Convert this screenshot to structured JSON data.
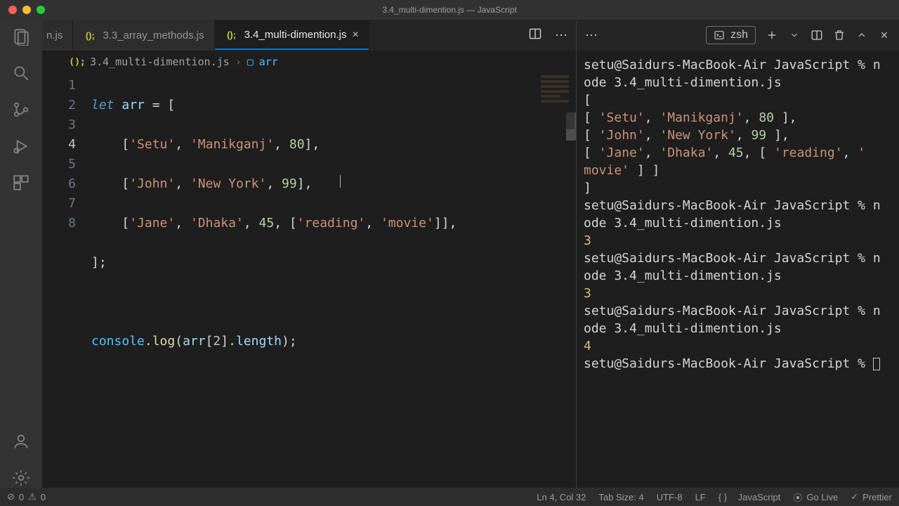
{
  "window": {
    "title": "3.4_multi-dimention.js — JavaScript"
  },
  "tabs": {
    "partial": "n.js",
    "t1": "3.3_array_methods.js",
    "t2": "3.4_multi-dimention.js"
  },
  "breadcrumb": {
    "file": "3.4_multi-dimention.js",
    "symbol": "arr"
  },
  "code": {
    "l1": {
      "kw": "let",
      "var": "arr"
    },
    "row1": {
      "a": "Setu",
      "b": "Manikganj",
      "n": "80"
    },
    "row2": {
      "a": "John",
      "b": "New York",
      "n": "99"
    },
    "row3": {
      "a": "Jane",
      "b": "Dhaka",
      "n": "45",
      "h1": "reading",
      "h2": "movie"
    },
    "log": {
      "obj": "console",
      "fn": "log",
      "var": "arr",
      "idx": "2",
      "prop": "length"
    }
  },
  "terminal": {
    "shell": "zsh",
    "prompt": "setu@Saidurs-MacBook-Air JavaScript % ",
    "cmd": "node 3.4_multi-dimention.js",
    "arr_open": "[",
    "r1": {
      "a": "'Setu'",
      "b": "'Manikganj'",
      "n": "80"
    },
    "r2": {
      "a": "'John'",
      "b": "'New York'",
      "n": "99"
    },
    "r3": {
      "a": "'Jane'",
      "b": "'Dhaka'",
      "n": "45",
      "h1": "'reading'",
      "h2": "'movie'"
    },
    "arr_close": "]",
    "out2": "3",
    "out3": "3",
    "out4": "4"
  },
  "status": {
    "errors": "0",
    "warnings": "0",
    "pos": "Ln 4, Col 32",
    "tab": "Tab Size: 4",
    "enc": "UTF-8",
    "eol": "LF",
    "lang": "JavaScript",
    "live": "Go Live",
    "prettier": "Prettier"
  }
}
